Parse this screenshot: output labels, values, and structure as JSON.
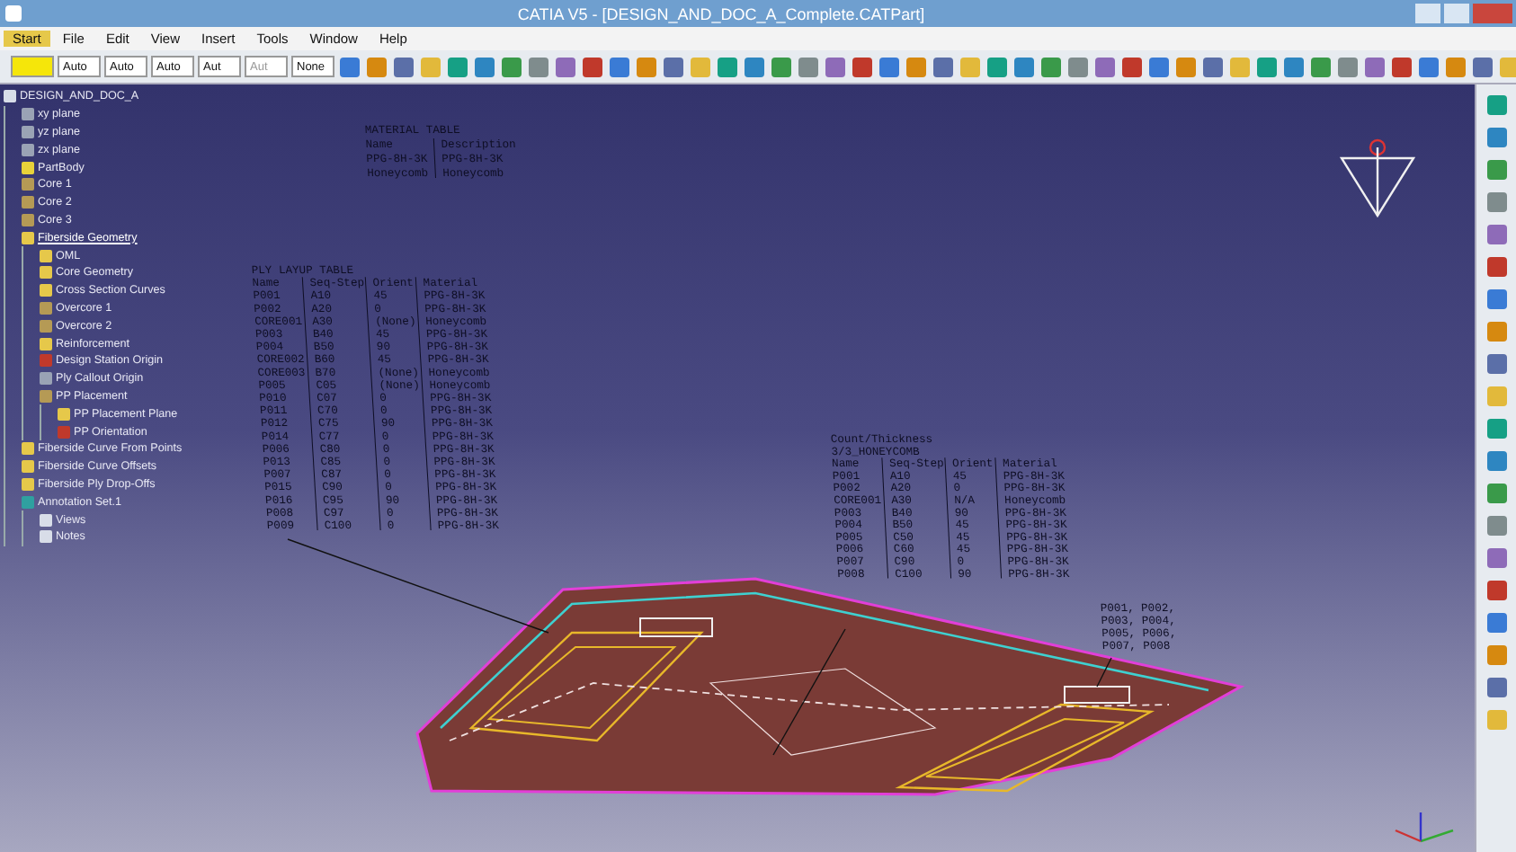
{
  "window": {
    "title": "CATIA V5 - [DESIGN_AND_DOC_A_Complete.CATPart]"
  },
  "menu": [
    {
      "label": "Start",
      "selected": true
    },
    {
      "label": "File",
      "selected": false
    },
    {
      "label": "Edit",
      "selected": false
    },
    {
      "label": "View",
      "selected": false
    },
    {
      "label": "Insert",
      "selected": false
    },
    {
      "label": "Tools",
      "selected": false
    },
    {
      "label": "Window",
      "selected": false
    },
    {
      "label": "Help",
      "selected": false
    }
  ],
  "toolbar": {
    "dropdowns": [
      {
        "kind": "color"
      },
      {
        "kind": "text",
        "value": "Auto",
        "disabled": false
      },
      {
        "kind": "text",
        "value": "Auto",
        "disabled": false
      },
      {
        "kind": "text",
        "value": "Auto",
        "disabled": false
      },
      {
        "kind": "text",
        "value": "Aut",
        "disabled": false
      },
      {
        "kind": "text",
        "value": "Aut",
        "disabled": true
      },
      {
        "kind": "text",
        "value": "None",
        "disabled": false
      }
    ]
  },
  "tree": {
    "root": {
      "label": "DESIGN_AND_DOC_A",
      "kind": "part",
      "selected": false,
      "children": [
        {
          "label": "xy plane",
          "kind": "plane",
          "selected": false
        },
        {
          "label": "yz plane",
          "kind": "plane",
          "selected": false
        },
        {
          "label": "zx plane",
          "kind": "plane",
          "selected": false
        },
        {
          "label": "PartBody",
          "kind": "body",
          "selected": false
        },
        {
          "label": "Core 1",
          "kind": "surface",
          "selected": false
        },
        {
          "label": "Core 2",
          "kind": "surface",
          "selected": false
        },
        {
          "label": "Core 3",
          "kind": "surface",
          "selected": false
        },
        {
          "label": "Fiberside Geometry",
          "kind": "set",
          "selected": true,
          "children": [
            {
              "label": "OML",
              "kind": "set",
              "selected": false
            },
            {
              "label": "Core Geometry",
              "kind": "set",
              "selected": false
            },
            {
              "label": "Cross Section Curves",
              "kind": "set",
              "selected": false
            },
            {
              "label": "Overcore 1",
              "kind": "surface",
              "selected": false
            },
            {
              "label": "Overcore 2",
              "kind": "surface",
              "selected": false
            },
            {
              "label": "Reinforcement",
              "kind": "set",
              "selected": false
            },
            {
              "label": "Design Station Origin",
              "kind": "point",
              "selected": false
            },
            {
              "label": "Ply Callout Origin",
              "kind": "plane",
              "selected": false
            },
            {
              "label": "PP Placement",
              "kind": "surface",
              "selected": false,
              "children": [
                {
                  "label": "PP Placement Plane",
                  "kind": "set",
                  "selected": false
                },
                {
                  "label": "PP Orientation",
                  "kind": "point",
                  "selected": false
                }
              ]
            }
          ]
        },
        {
          "label": "Fiberside Curve From Points",
          "kind": "set",
          "selected": false
        },
        {
          "label": "Fiberside Curve Offsets",
          "kind": "set",
          "selected": false
        },
        {
          "label": "Fiberside Ply Drop-Offs",
          "kind": "set",
          "selected": false
        },
        {
          "label": "Annotation Set.1",
          "kind": "annotation",
          "selected": false,
          "children": [
            {
              "label": "Views",
              "kind": "view",
              "selected": false
            },
            {
              "label": "Notes",
              "kind": "view",
              "selected": false
            }
          ]
        }
      ]
    }
  },
  "material_table": {
    "title": "MATERIAL TABLE",
    "columns": [
      "Name",
      "Description"
    ],
    "rows": [
      [
        "PPG-8H-3K",
        "PPG-8H-3K"
      ],
      [
        "Honeycomb",
        "Honeycomb"
      ]
    ]
  },
  "ply_table": {
    "title": "PLY LAYUP TABLE",
    "columns": [
      "Name",
      "Seq-Step",
      "Orient",
      "Material"
    ],
    "rows": [
      [
        "P001",
        "A10",
        "45",
        "PPG-8H-3K"
      ],
      [
        "P002",
        "A20",
        "0",
        "PPG-8H-3K"
      ],
      [
        "CORE001",
        "A30",
        "(None)",
        "Honeycomb"
      ],
      [
        "P003",
        "B40",
        "45",
        "PPG-8H-3K"
      ],
      [
        "P004",
        "B50",
        "90",
        "PPG-8H-3K"
      ],
      [
        "CORE002",
        "B60",
        "45",
        "PPG-8H-3K"
      ],
      [
        "CORE003",
        "B70",
        "(None)",
        "Honeycomb"
      ],
      [
        "P005",
        "C05",
        "(None)",
        "Honeycomb"
      ],
      [
        "P010",
        "C07",
        "0",
        "PPG-8H-3K"
      ],
      [
        "P011",
        "C70",
        "0",
        "PPG-8H-3K"
      ],
      [
        "P012",
        "C75",
        "90",
        "PPG-8H-3K"
      ],
      [
        "P014",
        "C77",
        "0",
        "PPG-8H-3K"
      ],
      [
        "P006",
        "C80",
        "0",
        "PPG-8H-3K"
      ],
      [
        "P013",
        "C85",
        "0",
        "PPG-8H-3K"
      ],
      [
        "P007",
        "C87",
        "0",
        "PPG-8H-3K"
      ],
      [
        "P015",
        "C90",
        "0",
        "PPG-8H-3K"
      ],
      [
        "P016",
        "C95",
        "90",
        "PPG-8H-3K"
      ],
      [
        "P008",
        "C97",
        "0",
        "PPG-8H-3K"
      ],
      [
        "P009",
        "C100",
        "0",
        "PPG-8H-3K"
      ]
    ]
  },
  "count_table": {
    "title": "Count/Thickness",
    "subtitle": "3/3_HONEYCOMB",
    "columns": [
      "Name",
      "Seq-Step",
      "Orient",
      "Material"
    ],
    "rows": [
      [
        "P001",
        "A10",
        "45",
        "PPG-8H-3K"
      ],
      [
        "P002",
        "A20",
        "0",
        "PPG-8H-3K"
      ],
      [
        "CORE001",
        "A30",
        "N/A",
        "Honeycomb"
      ],
      [
        "P003",
        "B40",
        "90",
        "PPG-8H-3K"
      ],
      [
        "P004",
        "B50",
        "45",
        "PPG-8H-3K"
      ],
      [
        "P005",
        "C50",
        "45",
        "PPG-8H-3K"
      ],
      [
        "P006",
        "C60",
        "45",
        "PPG-8H-3K"
      ],
      [
        "P007",
        "C90",
        "0",
        "PPG-8H-3K"
      ],
      [
        "P008",
        "C100",
        "90",
        "PPG-8H-3K"
      ]
    ]
  },
  "ply_callout": [
    "P001, P002,",
    "P003, P004,",
    "P005, P006,",
    "P007, P008"
  ]
}
